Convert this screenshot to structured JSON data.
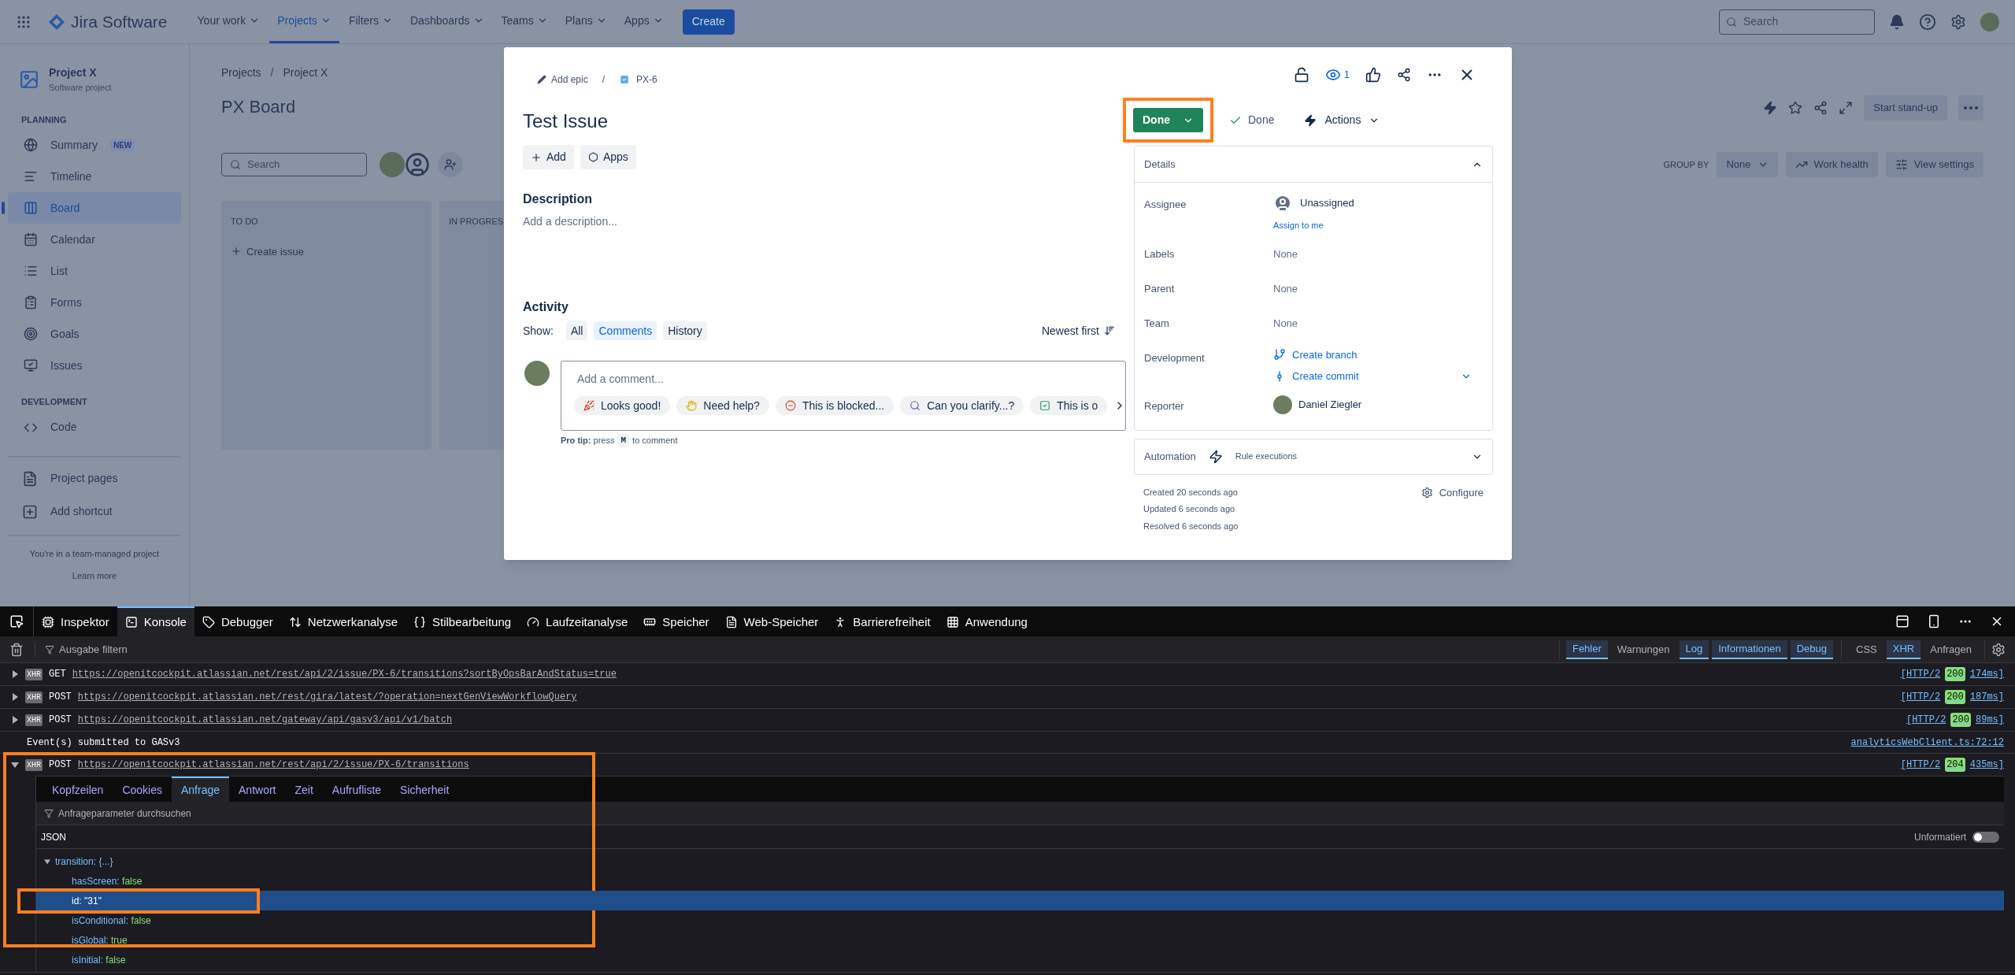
{
  "nav": {
    "product": "Jira Software",
    "items": [
      {
        "label": "Your work",
        "selected": false
      },
      {
        "label": "Projects",
        "selected": true
      },
      {
        "label": "Filters",
        "selected": false
      },
      {
        "label": "Dashboards",
        "selected": false
      },
      {
        "label": "Teams",
        "selected": false
      },
      {
        "label": "Plans",
        "selected": false
      },
      {
        "label": "Apps",
        "selected": false
      }
    ],
    "create": "Create",
    "search": {
      "placeholder": "Search"
    }
  },
  "sidebar": {
    "project": {
      "name": "Project X",
      "type": "Software project"
    },
    "planning": {
      "title": "PLANNING",
      "items": [
        {
          "label": "Summary",
          "badge": "NEW",
          "selected": false
        },
        {
          "label": "Timeline",
          "selected": false
        },
        {
          "label": "Board",
          "selected": true
        },
        {
          "label": "Calendar",
          "selected": false
        },
        {
          "label": "List",
          "selected": false
        },
        {
          "label": "Forms",
          "selected": false
        },
        {
          "label": "Goals",
          "selected": false
        },
        {
          "label": "Issues",
          "selected": false
        }
      ]
    },
    "development": {
      "title": "DEVELOPMENT",
      "items": [
        {
          "label": "Code",
          "selected": false
        }
      ]
    },
    "extra_items": [
      "Project pages",
      "Add shortcut"
    ],
    "note": "You're in a team-managed project",
    "learn_more": "Learn more"
  },
  "board": {
    "breadcrumbs": [
      "Projects",
      "Project X"
    ],
    "separator": "/",
    "title": "PX Board",
    "search": {
      "placeholder": "Search"
    },
    "start_standup": "Start stand-up",
    "group_by": {
      "label": "GROUP BY",
      "value": "None"
    },
    "buttons": [
      "Work health",
      "View settings"
    ],
    "columns": [
      {
        "title": "TO DO",
        "create": "Create issue"
      },
      {
        "title": "IN PROGRES"
      }
    ]
  },
  "issue": {
    "epic": "Add epic",
    "separator": "/",
    "key": "PX-6",
    "watchers": "1",
    "title": "Test Issue",
    "buttons": [
      "Add",
      "Apps"
    ],
    "description": {
      "heading": "Description",
      "placeholder": "Add a description..."
    },
    "activity": {
      "heading": "Activity",
      "show": "Show:",
      "filters": [
        {
          "label": "All",
          "selected": false
        },
        {
          "label": "Comments",
          "selected": true
        },
        {
          "label": "History",
          "selected": false
        }
      ],
      "sort": "Newest first",
      "comment_placeholder": "Add a comment...",
      "quick_replies": [
        "Looks good!",
        "Need help?",
        "This is blocked...",
        "Can you clarify...?",
        "This is o"
      ],
      "pro_tip": "**Pro tip:** press",
      "key": "M",
      "pro_tip_end": "to comment"
    },
    "status": {
      "label": "Done",
      "highlighted": true
    },
    "resolution": "Done",
    "actions": "Actions",
    "details": {
      "heading": "Details",
      "expanded": true,
      "fields": [
        {
          "label": "Assignee",
          "kind": "person",
          "value": "Unassigned",
          "link": "Assign to me"
        },
        {
          "label": "Labels",
          "kind": "text",
          "value": "None"
        },
        {
          "label": "Parent",
          "kind": "text",
          "value": "None"
        },
        {
          "label": "Team",
          "kind": "text",
          "value": "None"
        },
        {
          "label": "Development",
          "kind": "links",
          "links": [
            "Create branch",
            "Create commit"
          ]
        },
        {
          "label": "Reporter",
          "kind": "photo",
          "value": "Daniel Ziegler"
        }
      ]
    },
    "automation": {
      "heading": "Automation",
      "link": "Rule executions"
    },
    "timestamps": [
      "Created 20 seconds ago",
      "Updated 6 seconds ago",
      "Resolved 6 seconds ago"
    ],
    "configure": "Configure"
  },
  "devtools": {
    "tabs": [
      {
        "label": "Inspektor",
        "selected": false
      },
      {
        "label": "Konsole",
        "selected": true
      },
      {
        "label": "Debugger",
        "selected": false
      },
      {
        "label": "Netzwerkanalyse",
        "selected": false
      },
      {
        "label": "Stilbearbeitung",
        "selected": false
      },
      {
        "label": "Laufzeitanalyse",
        "selected": false
      },
      {
        "label": "Speicher",
        "selected": false
      },
      {
        "label": "Web-Speicher",
        "selected": false
      },
      {
        "label": "Barrierefreiheit",
        "selected": false
      },
      {
        "label": "Anwendung",
        "selected": false
      }
    ],
    "filter_placeholder": "Ausgabe filtern",
    "levels": [
      {
        "label": "Fehler",
        "selected": true
      },
      {
        "label": "Warnungen",
        "selected": false
      },
      {
        "label": "Log",
        "selected": true
      },
      {
        "label": "Informationen",
        "selected": true
      },
      {
        "label": "Debug",
        "selected": true
      }
    ],
    "types": [
      {
        "label": "CSS",
        "selected": false
      },
      {
        "label": "XHR",
        "selected": true
      },
      {
        "label": "Anfragen",
        "selected": false
      }
    ],
    "entries": [
      {
        "kind": "xhr",
        "expanded": false,
        "highlighted": false,
        "badge": "XHR",
        "method": "GET",
        "url": "https://openitcockpit.atlassian.net/rest/api/2/issue/PX-6/transitions?sortByOpsBarAndStatus=true",
        "protocol": "[HTTP/2",
        "status": "200",
        "time": "174ms]"
      },
      {
        "kind": "xhr",
        "expanded": false,
        "highlighted": false,
        "badge": "XHR",
        "method": "POST",
        "url": "https://openitcockpit.atlassian.net/rest/gira/latest/?operation=nextGenViewWorkflowQuery",
        "protocol": "[HTTP/2",
        "status": "200",
        "time": "187ms]"
      },
      {
        "kind": "xhr",
        "expanded": false,
        "highlighted": false,
        "badge": "XHR",
        "method": "POST",
        "url": "https://openitcockpit.atlassian.net/gateway/api/gasv3/api/v1/batch",
        "protocol": "[HTTP/2",
        "status": "200",
        "time": "89ms]"
      },
      {
        "kind": "log",
        "text": "Event(s) submitted to GASv3",
        "source": "analyticsWebClient.ts:72:12"
      },
      {
        "kind": "xhr",
        "expanded": true,
        "highlighted": true,
        "badge": "XHR",
        "method": "POST",
        "url": "https://openitcockpit.atlassian.net/rest/api/2/issue/PX-6/transitions",
        "protocol": "[HTTP/2",
        "status": "204",
        "time": "435ms]"
      }
    ],
    "request_panel": {
      "tabs": [
        {
          "label": "Kopfzeilen",
          "selected": false
        },
        {
          "label": "Cookies",
          "selected": false
        },
        {
          "label": "Anfrage",
          "selected": true
        },
        {
          "label": "Antwort",
          "selected": false
        },
        {
          "label": "Zeit",
          "selected": false
        },
        {
          "label": "Aufrufliste",
          "selected": false
        },
        {
          "label": "Sicherheit",
          "selected": false
        }
      ],
      "filter_placeholder": "Anfrageparameter durchsuchen",
      "section": "JSON",
      "raw_label": "Unformatiert",
      "raw": false,
      "tree": {
        "key": "transition:",
        "summary": "{...}",
        "expanded": true,
        "children": [
          {
            "key": "hasScreen:",
            "value": "false",
            "selected": false,
            "highlighted": false
          },
          {
            "key": "id:",
            "value": "\"31\"",
            "selected": true,
            "highlighted": true
          },
          {
            "key": "isConditional:",
            "value": "false",
            "selected": false,
            "highlighted": false
          },
          {
            "key": "isGlobal:",
            "value": "true",
            "selected": false,
            "highlighted": false
          },
          {
            "key": "isInitial:",
            "value": "false",
            "selected": false,
            "highlighted": false
          }
        ]
      }
    }
  }
}
